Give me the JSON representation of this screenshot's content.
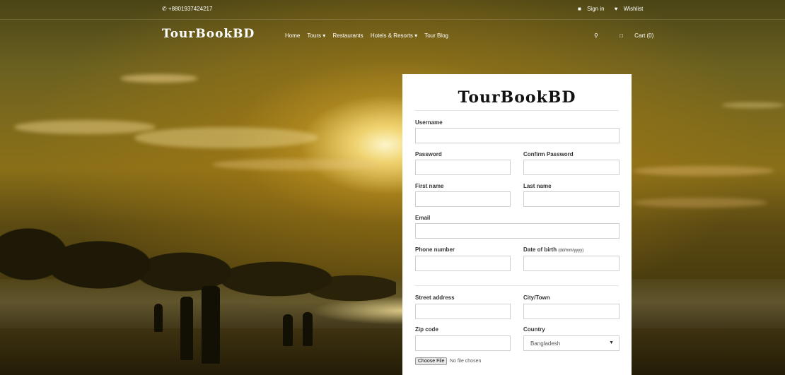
{
  "topbar": {
    "phone": "+8801937424217",
    "sign_in": "Sign in",
    "wishlist": "Wishlist"
  },
  "navbar": {
    "logo": "TourBookBD",
    "menu": [
      "Home",
      "Tours ▾",
      "Restaurants",
      "Hotels & Resorts ▾",
      "Tour Blog"
    ],
    "cart": "Cart (0)"
  },
  "form": {
    "title": "TourBookBD",
    "username_label": "Username",
    "password_label": "Password",
    "confirm_password_label": "Confirm Password",
    "first_name_label": "First name",
    "last_name_label": "Last name",
    "email_label": "Email",
    "phone_label": "Phone number",
    "dob_label": "Date of birth",
    "dob_hint": "(dd/mm/yyyy)",
    "street_label": "Street address",
    "city_label": "City/Town",
    "zip_label": "Zip code",
    "country_label": "Country",
    "country_value": "Bangladesh",
    "file_button": "Choose File",
    "file_status": "No file chosen"
  },
  "icons": {
    "phone": "phone-icon",
    "user": "user-icon",
    "heart": "heart-icon",
    "search": "search-icon",
    "cart": "cart-icon"
  }
}
